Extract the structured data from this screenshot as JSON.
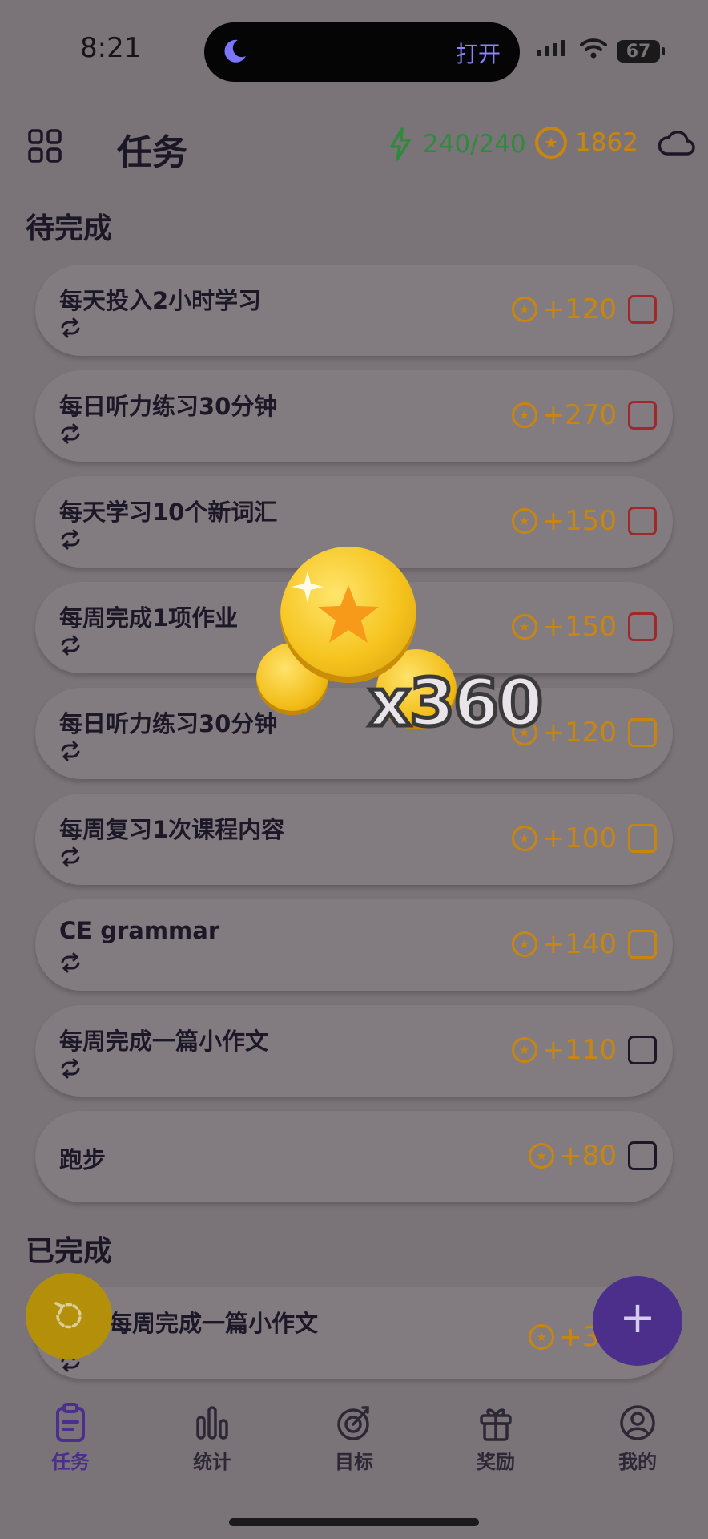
{
  "status_bar": {
    "time": "8:21",
    "island_action": "打开",
    "battery": "67"
  },
  "header": {
    "title": "任务",
    "energy": "240/240",
    "coins": "1862"
  },
  "sections": {
    "pending": "待完成",
    "completed": "已完成"
  },
  "pending_tasks": [
    {
      "title": "每天投入2小时学习",
      "reward": "+120"
    },
    {
      "title": "每日听力练习30分钟",
      "reward": "+270"
    },
    {
      "title": "每天学习10个新词汇",
      "reward": "+150"
    },
    {
      "title": "每周完成1项作业",
      "reward": "+150"
    },
    {
      "title": "每日听力练习30分钟",
      "reward": "+120"
    },
    {
      "title": "每周复习1次课程内容",
      "reward": "+100"
    },
    {
      "title": "CE grammar",
      "reward": "+140"
    },
    {
      "title": "每周完成一篇小作文",
      "reward": "+110"
    },
    {
      "title": "跑步",
      "reward": "+80"
    }
  ],
  "completed_tasks": [
    {
      "title": "每周完成一篇小作文",
      "reward": "+36"
    }
  ],
  "reward_popup": {
    "count": "x360"
  },
  "fab": {
    "add": "+"
  },
  "nav": [
    {
      "label": "任务",
      "icon": "clipboard-icon"
    },
    {
      "label": "统计",
      "icon": "bar-chart-icon"
    },
    {
      "label": "目标",
      "icon": "target-icon"
    },
    {
      "label": "奖励",
      "icon": "gift-icon"
    },
    {
      "label": "我的",
      "icon": "profile-icon"
    }
  ],
  "colors": {
    "accent": "#4a2f8e",
    "coin": "#c8860f",
    "energy": "#2f8a3e",
    "overlay": "#7a7479"
  }
}
